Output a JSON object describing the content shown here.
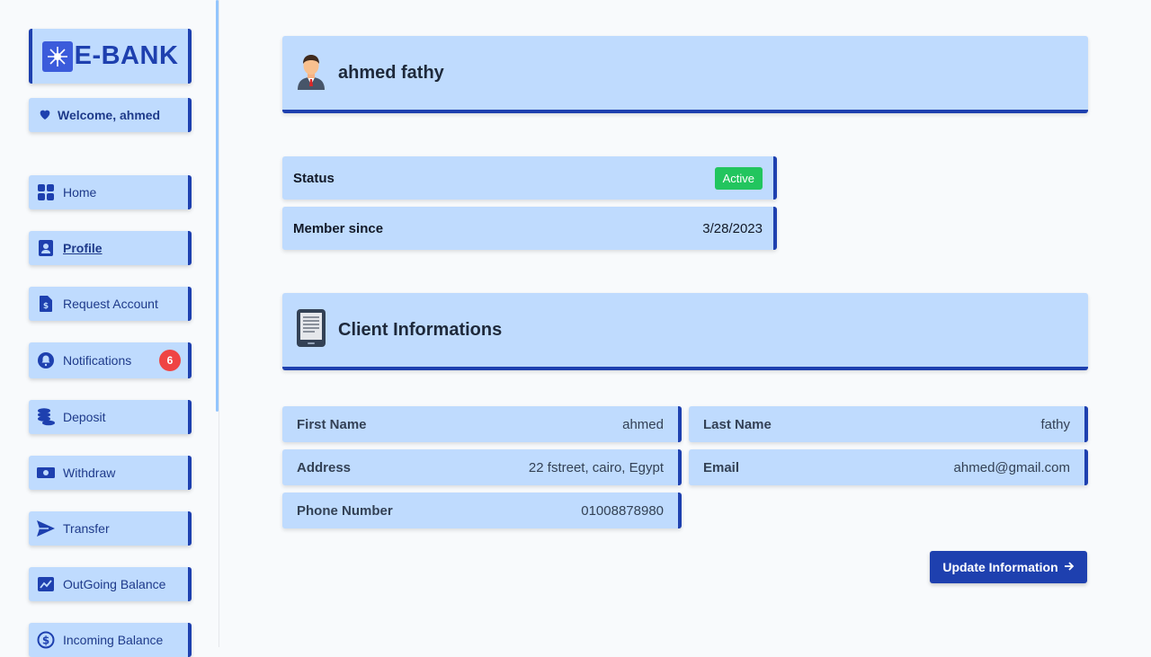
{
  "brand": {
    "name": "E-BANK"
  },
  "welcome": {
    "text": "Welcome, ahmed"
  },
  "sidebar": {
    "items": [
      {
        "label": "Home",
        "icon": "grid-icon"
      },
      {
        "label": "Profile",
        "icon": "id-card-icon",
        "active": true
      },
      {
        "label": "Request Account",
        "icon": "dollar-document-icon"
      },
      {
        "label": "Notifications",
        "icon": "bell-icon",
        "badge": "6"
      },
      {
        "label": "Deposit",
        "icon": "coins-icon"
      },
      {
        "label": "Withdraw",
        "icon": "money-bill-icon"
      },
      {
        "label": "Transfer",
        "icon": "send-icon"
      },
      {
        "label": "OutGoing Balance",
        "icon": "chart-up-icon"
      },
      {
        "label": "Incoming Balance",
        "icon": "dollar-circle-icon"
      }
    ]
  },
  "profile": {
    "name": "ahmed fathy",
    "status_label": "Status",
    "status_value": "Active",
    "member_label": "Member since",
    "member_value": "3/28/2023"
  },
  "client_info": {
    "title": "Client Informations",
    "first_name_label": "First Name",
    "first_name_value": "ahmed",
    "last_name_label": "Last Name",
    "last_name_value": "fathy",
    "address_label": "Address",
    "address_value": "22 fstreet, cairo, Egypt",
    "email_label": "Email",
    "email_value": "ahmed@gmail.com",
    "phone_label": "Phone Number",
    "phone_value": "01008878980"
  },
  "actions": {
    "update_label": "Update Information"
  },
  "colors": {
    "accent": "#1e40af",
    "card": "#bfdbfe",
    "active_badge": "#22c55e",
    "notification_badge": "#ef4444"
  }
}
